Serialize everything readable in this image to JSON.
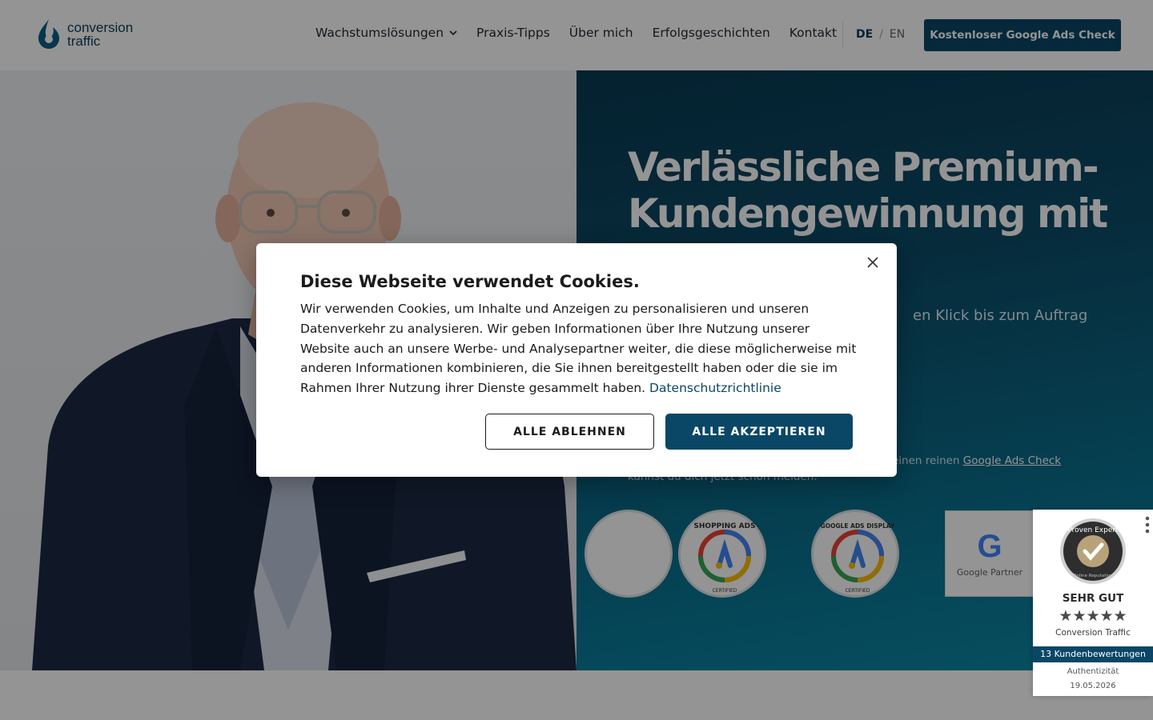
{
  "header": {
    "logo": {
      "line1": "conversion",
      "line2": "traffic"
    },
    "nav": [
      {
        "label": "Wachstumslösungen",
        "has_dropdown": true
      },
      {
        "label": "Praxis-Tipps"
      },
      {
        "label": "Über mich"
      },
      {
        "label": "Erfolgsgeschichten"
      },
      {
        "label": "Kontakt"
      }
    ],
    "lang": {
      "de": "DE",
      "separator": "/",
      "en": "EN"
    },
    "cta_label": "Kostenloser Google Ads Check"
  },
  "hero": {
    "headline": "Verlässliche Premium-Kundengewinnung mit",
    "subline_visible": "en Klick bis zum Auftrag",
    "small_text_visible": "einen reinen",
    "small_text_link": "Google Ads Check",
    "small_text_line2": "kannst du dich jetzt schon melden.",
    "badges": [
      {
        "label": "SHOPPING ADS",
        "sub": "CERTIFIED"
      },
      {
        "label": "GOOGLE ADS DISPLAY",
        "sub": "CERTIFIED"
      }
    ],
    "partner_label": "Google Partner"
  },
  "proven_expert": {
    "seal_text": "Proven Expert",
    "seal_sub": "Online Reputation",
    "rating": "SEHR GUT",
    "stars": "★★★★★",
    "name": "Conversion Traffic",
    "reviews": "13 Kundenbewertungen",
    "auth_label": "Authentizität",
    "date": "19.05.2026"
  },
  "cookie_modal": {
    "title": "Diese Webseite verwendet Cookies.",
    "body": "Wir verwenden Cookies, um Inhalte und Anzeigen zu personalisieren und unseren Datenverkehr zu analysieren. Wir geben Informationen über Ihre Nutzung unserer Website auch an unsere Werbe- und Analysepartner weiter, die diese möglicherweise mit anderen Informationen kombinieren, die Sie ihnen bereitgestellt haben oder die sie im Rahmen Ihrer Nutzung ihrer Dienste gesammelt haben.",
    "privacy_link": "Datenschutzrichtlinie",
    "decline_label": "ALLE ABLEHNEN",
    "accept_label": "ALLE AKZEPTIEREN"
  },
  "colors": {
    "brand_dark": "#0a4766",
    "hero_gradient_start": "#0a3a52",
    "hero_gradient_end": "#0b8aa6"
  }
}
